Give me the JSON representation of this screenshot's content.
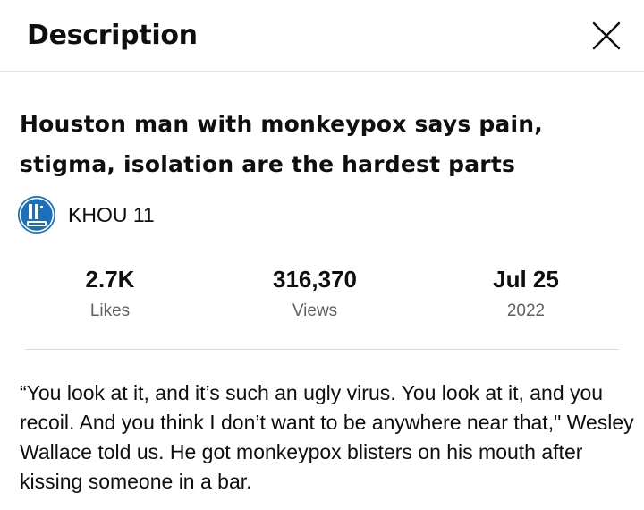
{
  "header": {
    "title": "Description",
    "close_icon": "close-icon"
  },
  "video": {
    "title": "Houston man with monkeypox says pain, stigma, isolation are the hardest parts"
  },
  "channel": {
    "name": "KHOU 11",
    "avatar_icon": "khou-11-logo",
    "avatar_color": "#1c6fbd"
  },
  "stats": {
    "likes": {
      "value": "2.7K",
      "label": "Likes"
    },
    "views": {
      "value": "316,370",
      "label": "Views"
    },
    "date": {
      "value": "Jul 25",
      "label": "2022"
    }
  },
  "description": {
    "text": "“You look at it, and it’s such an ugly virus. You look at it, and you recoil. And you think I don’t want to be anywhere near that,\" Wesley Wallace told us. He got monkeypox blisters on his mouth after kissing someone in a bar."
  }
}
